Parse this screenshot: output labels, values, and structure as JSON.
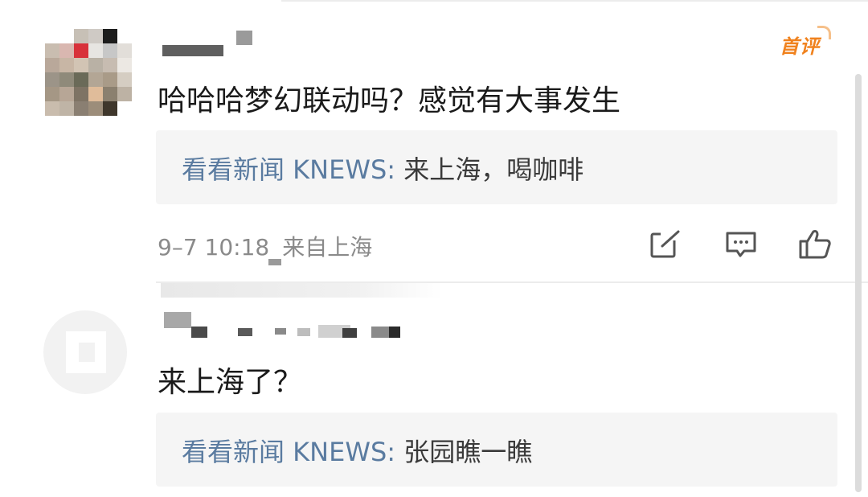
{
  "comments": [
    {
      "badge": "首评",
      "text": "哈哈哈梦幻联动吗？感觉有大事发生",
      "reply": {
        "author": "看看新闻 KNEWS",
        "separator": ":",
        "content": "来上海，喝咖啡"
      },
      "time": "9–7 10:18",
      "location": "来自上海"
    },
    {
      "text": "来上海了？",
      "reply": {
        "author": "看看新闻 KNEWS",
        "separator": ":",
        "content": "张园瞧一瞧"
      }
    }
  ],
  "icons": {
    "edit": "edit-icon",
    "reply": "reply-icon",
    "like": "like-icon"
  },
  "colors": {
    "reply_author": "#5a7ba0",
    "badge": "#f0821e",
    "reply_bg": "#f5f5f5"
  }
}
